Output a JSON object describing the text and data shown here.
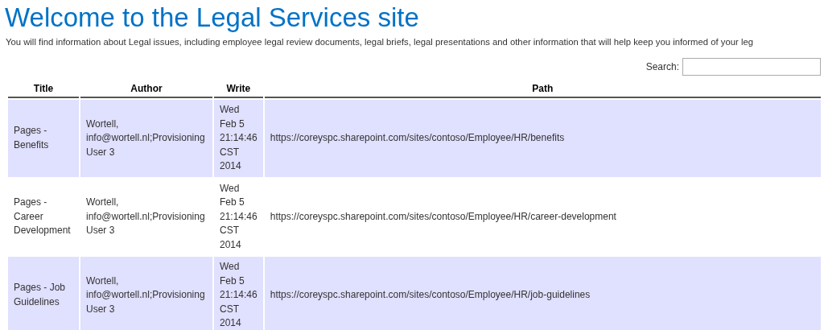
{
  "title": "Welcome to the Legal Services site",
  "intro": "You will find information about Legal issues, including employee legal review documents, legal briefs, legal presentations and other information that will help keep you informed of your leg",
  "search": {
    "label": "Search:"
  },
  "table": {
    "columns": [
      "Title",
      "Author",
      "Write",
      "Path"
    ],
    "rows": [
      {
        "cells": [
          "Pages - Benefits",
          "Wortell, info@wortell.nl;Provisioning User 3",
          "Wed Feb 5 21:14:46 CST 2014",
          "https://coreyspc.sharepoint.com/sites/contoso/Employee/HR/benefits"
        ]
      },
      {
        "cells": [
          "Pages - Career Development",
          "Wortell, info@wortell.nl;Provisioning User 3",
          "Wed Feb 5 21:14:46 CST 2014",
          "https://coreyspc.sharepoint.com/sites/contoso/Employee/HR/career-development"
        ]
      },
      {
        "cells": [
          "Pages - Job Guidelines",
          "Wortell, info@wortell.nl;Provisioning User 3",
          "Wed Feb 5 21:14:46 CST 2014",
          "https://coreyspc.sharepoint.com/sites/contoso/Employee/HR/job-guidelines"
        ]
      }
    ]
  }
}
